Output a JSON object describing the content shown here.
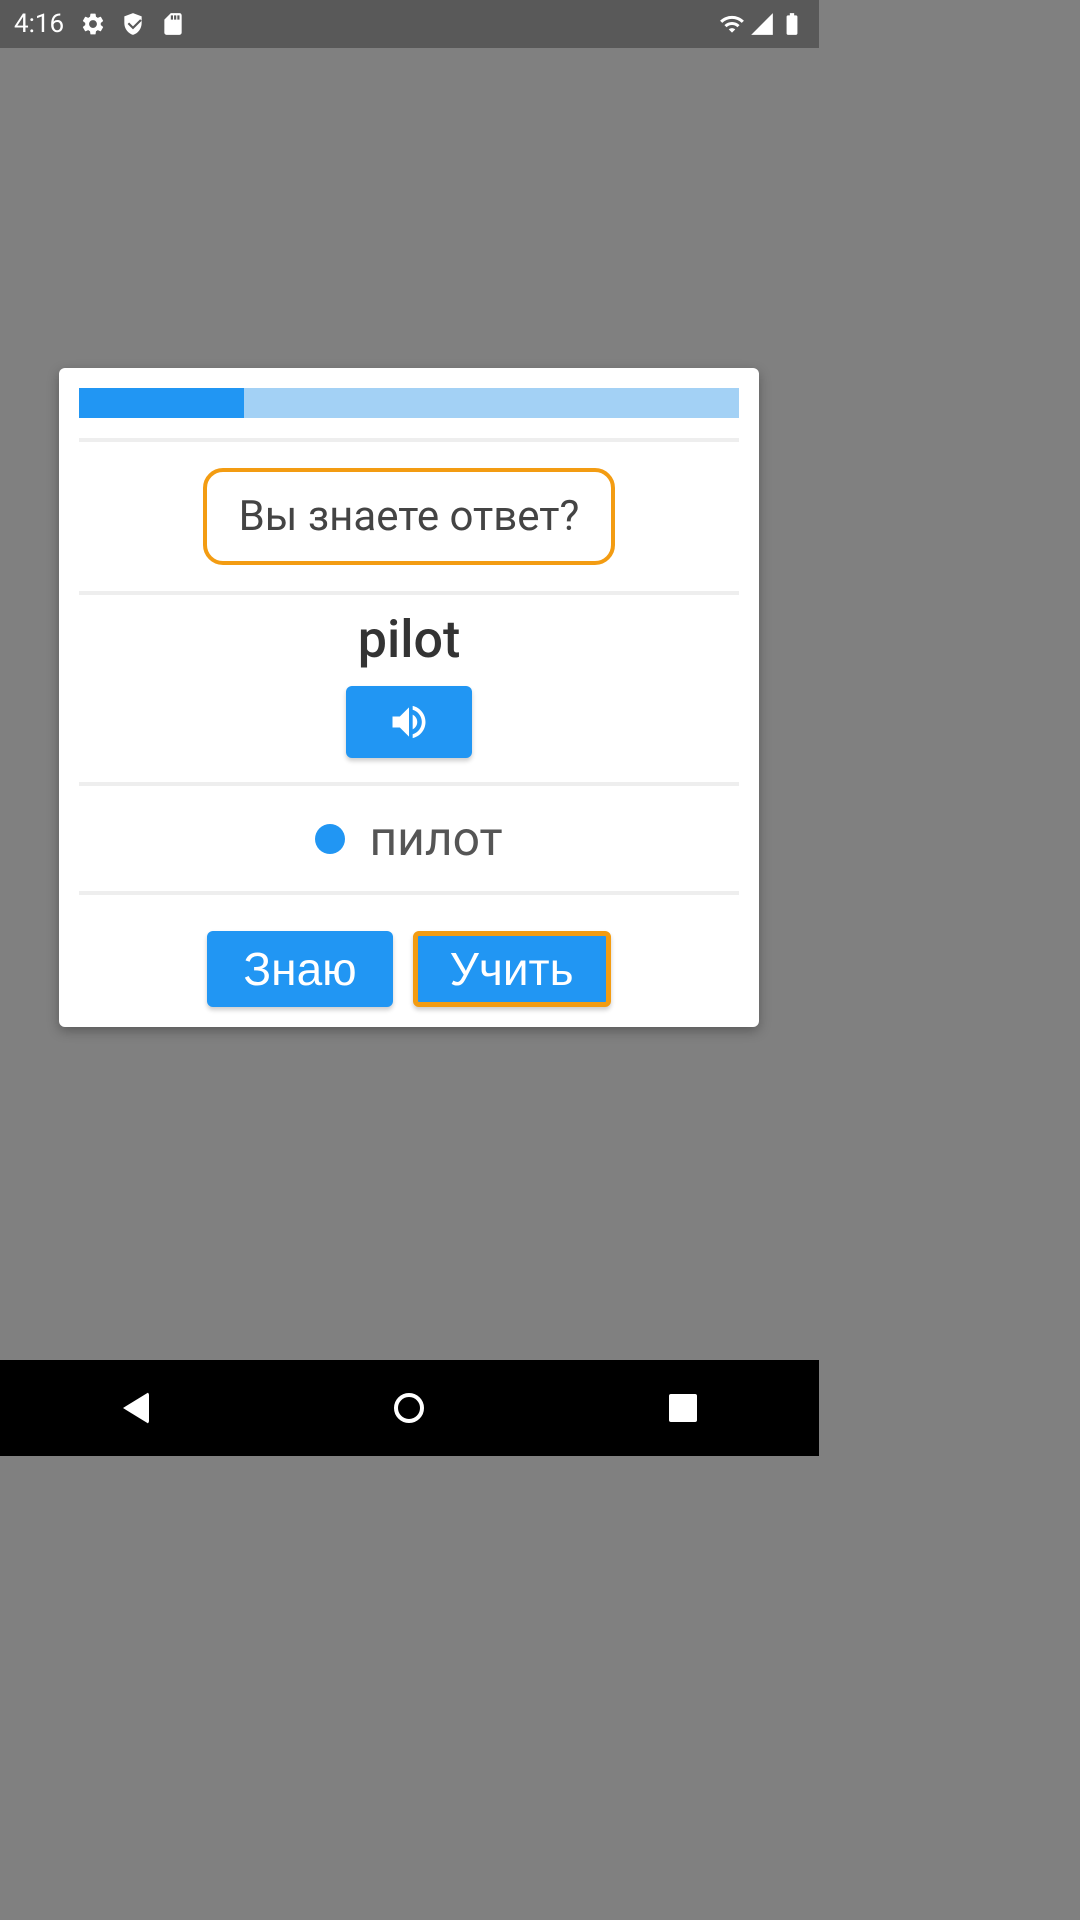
{
  "status_bar": {
    "time": "4:16"
  },
  "card": {
    "progress_percent": 25,
    "question": "Вы знаете ответ?",
    "word": "pilot",
    "translation": "пилот",
    "buttons": {
      "know": "Знаю",
      "learn": "Учить"
    }
  },
  "colors": {
    "primary": "#2196F3",
    "highlight": "#F39C12",
    "progress_bg": "#A3D1F5"
  }
}
